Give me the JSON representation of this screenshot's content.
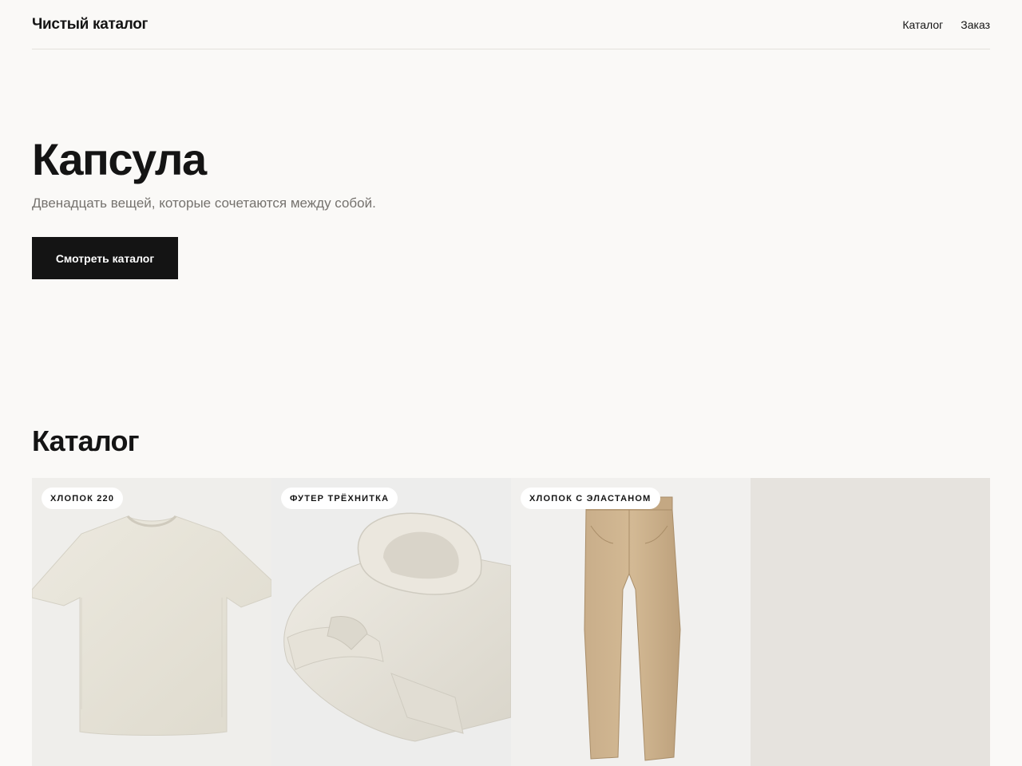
{
  "header": {
    "brand": "Чистый каталог",
    "nav": [
      {
        "label": "Каталог"
      },
      {
        "label": "Заказ"
      }
    ]
  },
  "hero": {
    "title": "Капсула",
    "subtitle": "Двенадцать вещей, которые сочетаются между собой.",
    "cta_label": "Смотреть каталог"
  },
  "catalog": {
    "title": "Каталог",
    "products": [
      {
        "tag": "ХЛОПОК 220",
        "image": "t-shirt-image",
        "color": "#e9e6dc"
      },
      {
        "tag": "ФУТЕР ТРЁХНИТКА",
        "image": "hoodie-image",
        "color": "#e8e5dd"
      },
      {
        "tag": "ХЛОПОК С ЭЛАСТАНОМ",
        "image": "chinos-image",
        "color": "#c8ad8a"
      },
      {
        "tag": "",
        "image": "placeholder-image",
        "color": "#e6e3de"
      }
    ]
  }
}
